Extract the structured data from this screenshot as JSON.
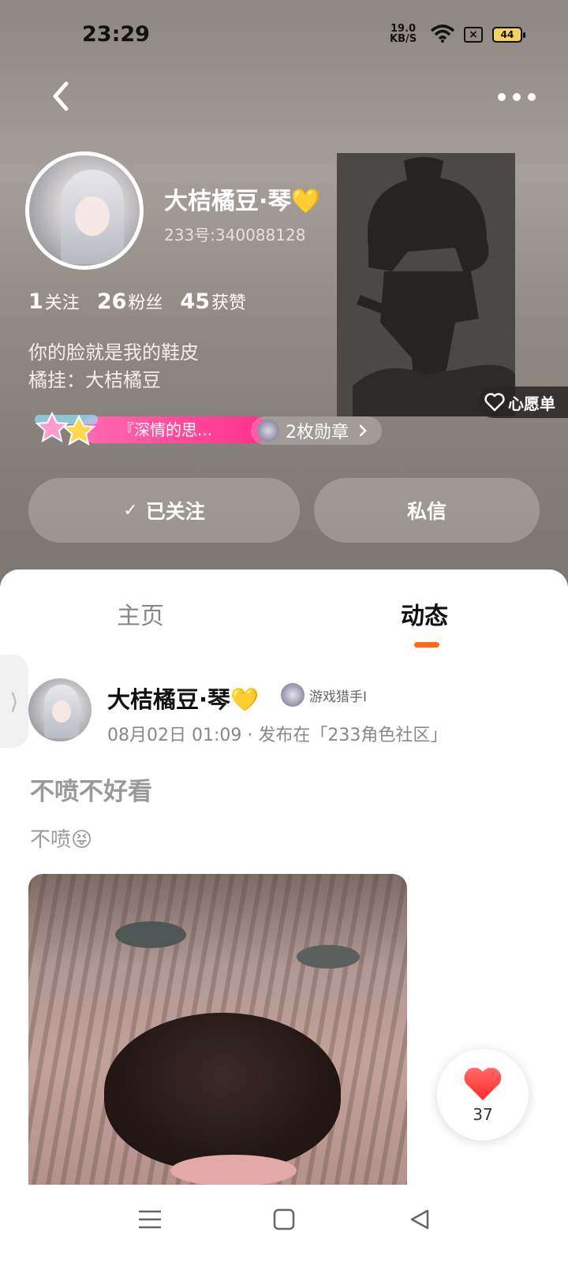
{
  "status": {
    "time": "23:29",
    "net_speed_value": "19.0",
    "net_speed_unit": "KB/S",
    "battery": "44"
  },
  "profile": {
    "name": "大桔橘豆·琴💛",
    "id": "233号:340088128",
    "stats": [
      {
        "num": "1",
        "label": "关注"
      },
      {
        "num": "26",
        "label": "粉丝"
      },
      {
        "num": "45",
        "label": "获赞"
      }
    ],
    "bio_line1": "你的脸就是我的鞋皮",
    "bio_line2": "橘挂：大桔橘豆",
    "title_badge": "『深情的思...",
    "medals": "2枚勋章",
    "wish_list": "心愿单",
    "follow_label": "已关注",
    "message_label": "私信"
  },
  "tabs": {
    "home": "主页",
    "feed": "动态"
  },
  "post": {
    "author": "大桔橘豆·琴💛",
    "badge": "游戏猎手I",
    "meta": "08月02日 01:09 · 发布在「233角色社区」",
    "title": "不喷不好看",
    "text": "不喷😝",
    "likes": "37"
  },
  "colors": {
    "accent": "#ff6a1a",
    "badge_pink": "#ff2f8c",
    "like_red": "#ff3b3b"
  },
  "icons": [
    "back-icon",
    "more-icon",
    "heart-outline-icon",
    "chevron-right-icon",
    "check-icon",
    "heart-icon",
    "menu-icon",
    "home-square-icon",
    "back-triangle-icon"
  ]
}
